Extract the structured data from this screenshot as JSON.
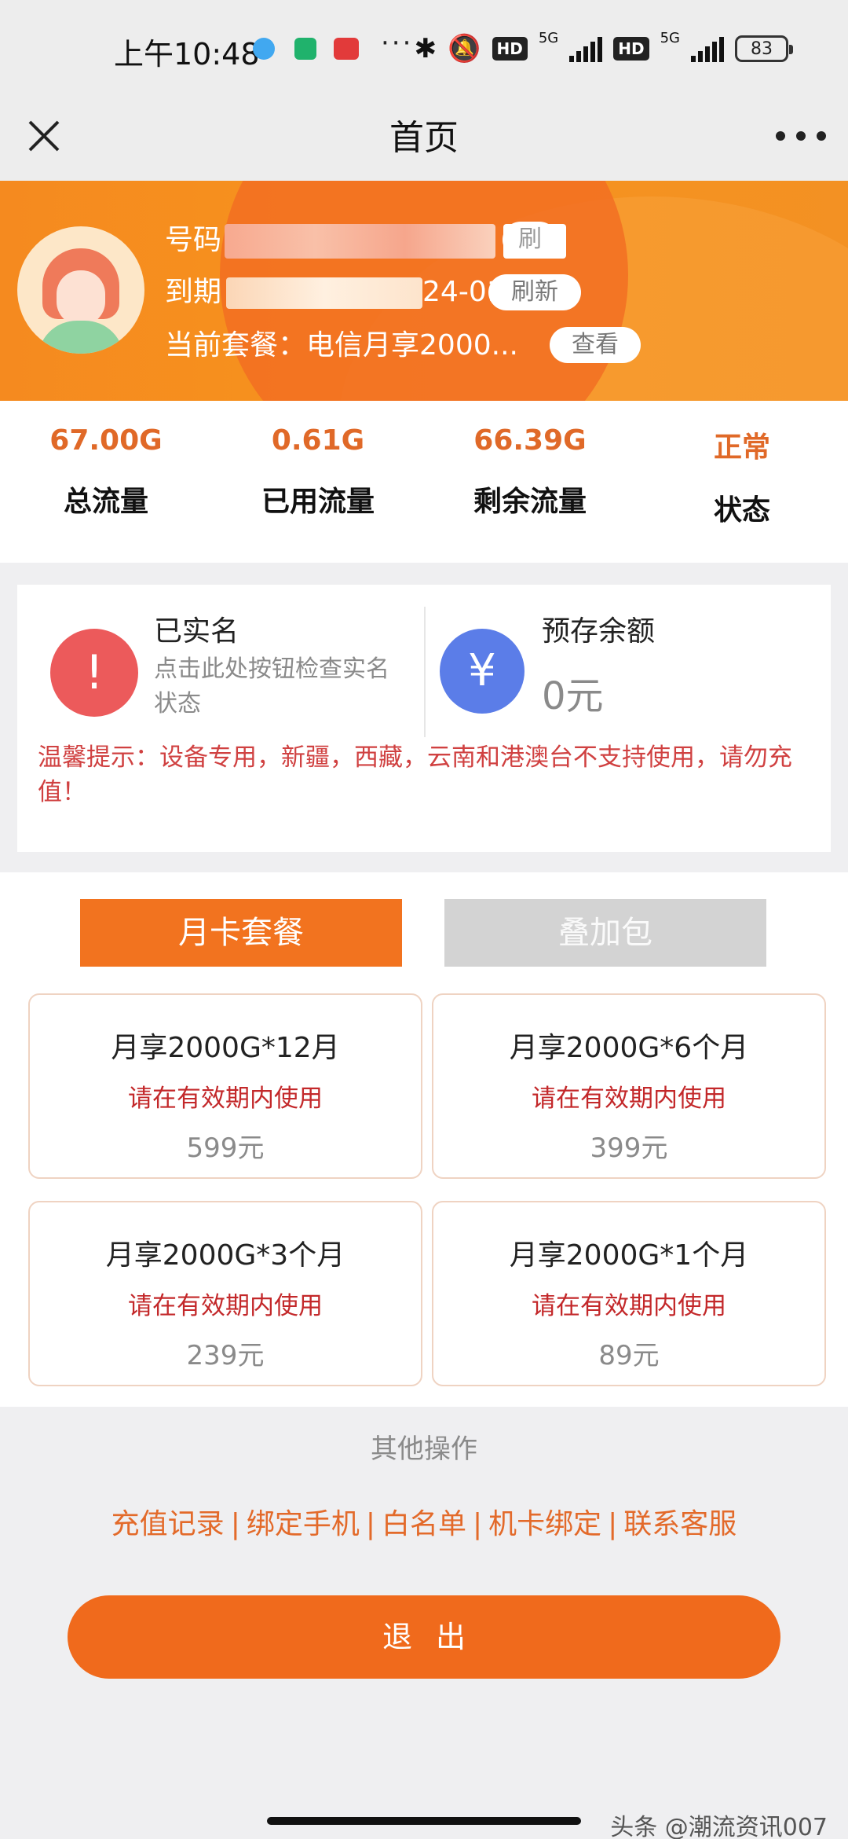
{
  "status_bar": {
    "time": "上午10:48",
    "dots": "···",
    "hd1": "HD",
    "net1": "5G",
    "hd2": "HD",
    "net2": "5G",
    "battery": "83",
    "icons": [
      "telegram-icon",
      "download-icon",
      "app-icon",
      "bluetooth-icon",
      "mute-icon"
    ]
  },
  "nav": {
    "title": "首页"
  },
  "account": {
    "phone_label": "号码",
    "expiry_label": "到期",
    "expiry_value_partial": "24-01-01",
    "plan_label": "当前套餐：",
    "plan_value": "电信月享2000...",
    "btn_phone": "刷",
    "btn_refresh": "刷新",
    "btn_view": "查看"
  },
  "stats": [
    {
      "value": "67.00G",
      "label": "总流量"
    },
    {
      "value": "0.61G",
      "label": "已用流量"
    },
    {
      "value": "66.39G",
      "label": "剩余流量"
    },
    {
      "value": "正常",
      "label": "状态"
    }
  ],
  "verification": {
    "title": "已实名",
    "hint": "点击此处按钮检查实名状态",
    "icon": "!"
  },
  "deposit": {
    "title": "预存余额",
    "value": "0元",
    "icon": "¥"
  },
  "warning": "温馨提示：设备专用，新疆，西藏，云南和港澳台不支持使用，请勿充值！",
  "tabs": {
    "monthly": "月卡套餐",
    "addon": "叠加包"
  },
  "packages": [
    {
      "name": "月享2000G*12月",
      "note": "请在有效期内使用",
      "price": "599元"
    },
    {
      "name": "月享2000G*6个月",
      "note": "请在有效期内使用",
      "price": "399元"
    },
    {
      "name": "月享2000G*3个月",
      "note": "请在有效期内使用",
      "price": "239元"
    },
    {
      "name": "月享2000G*1个月",
      "note": "请在有效期内使用",
      "price": "89元"
    }
  ],
  "ops": {
    "title": "其他操作",
    "links": [
      "充值记录",
      "绑定手机",
      "白名单",
      "机卡绑定",
      "联系客服"
    ],
    "separator": "|"
  },
  "logout": "退出",
  "watermark": "头条 @潮流资讯007",
  "colors": {
    "accent": "#f2731f",
    "header": "#f7931e",
    "warning": "#d04141",
    "stat_value": "#e06928"
  }
}
